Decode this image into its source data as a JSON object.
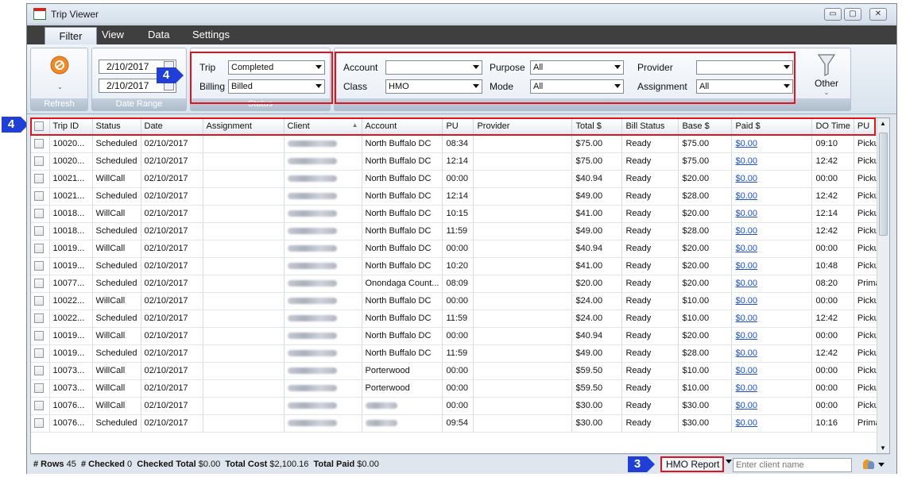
{
  "window": {
    "title": "Trip Viewer"
  },
  "titlebar_buttons": {
    "minimize": "▭",
    "maximize": "▢",
    "close": "✕"
  },
  "menu": {
    "tabs": [
      "Filter",
      "View",
      "Data",
      "Settings"
    ],
    "active": "Filter"
  },
  "ribbon": {
    "refresh": {
      "label": "Refresh"
    },
    "date_range": {
      "label": "Date Range",
      "from": "2/10/2017",
      "to": "2/10/2017"
    },
    "status": {
      "label": "Status",
      "trip_label": "Trip",
      "trip_value": "Completed",
      "billing_label": "Billing",
      "billing_value": "Billed"
    },
    "filters": {
      "account_label": "Account",
      "account_value": "",
      "class_label": "Class",
      "class_value": "HMO",
      "purpose_label": "Purpose",
      "purpose_value": "All",
      "mode_label": "Mode",
      "mode_value": "All",
      "provider_label": "Provider",
      "provider_value": "",
      "assignment_label": "Assignment",
      "assignment_value": "All"
    },
    "other": {
      "label": "Other"
    }
  },
  "markers": {
    "status": "4",
    "header": "4",
    "report": "3"
  },
  "grid": {
    "columns": [
      "Trip ID",
      "Status",
      "Date",
      "Assignment",
      "Client",
      "Account",
      "PU",
      "Provider",
      "Total $",
      "Bill Status",
      "Base $",
      "Paid $",
      "DO Time",
      "PU"
    ],
    "rows": [
      {
        "id": "10020...",
        "status": "Scheduled",
        "date": "02/10/2017",
        "account": "North Buffalo DC",
        "pu": "08:34",
        "total": "$75.00",
        "bill": "Ready",
        "base": "$75.00",
        "paid": "$0.00",
        "do": "09:10",
        "pu2": "Picku"
      },
      {
        "id": "10020...",
        "status": "Scheduled",
        "date": "02/10/2017",
        "account": "North Buffalo DC",
        "pu": "12:14",
        "total": "$75.00",
        "bill": "Ready",
        "base": "$75.00",
        "paid": "$0.00",
        "do": "12:42",
        "pu2": "Picku"
      },
      {
        "id": "10021...",
        "status": "WillCall",
        "date": "02/10/2017",
        "account": "North Buffalo DC",
        "pu": "00:00",
        "total": "$40.94",
        "bill": "Ready",
        "base": "$20.00",
        "paid": "$0.00",
        "do": "00:00",
        "pu2": "Picku"
      },
      {
        "id": "10021...",
        "status": "Scheduled",
        "date": "02/10/2017",
        "account": "North Buffalo DC",
        "pu": "12:14",
        "total": "$49.00",
        "bill": "Ready",
        "base": "$28.00",
        "paid": "$0.00",
        "do": "12:42",
        "pu2": "Picku"
      },
      {
        "id": "10018...",
        "status": "WillCall",
        "date": "02/10/2017",
        "account": "North Buffalo DC",
        "pu": "10:15",
        "total": "$41.00",
        "bill": "Ready",
        "base": "$20.00",
        "paid": "$0.00",
        "do": "12:14",
        "pu2": "Picku"
      },
      {
        "id": "10018...",
        "status": "Scheduled",
        "date": "02/10/2017",
        "account": "North Buffalo DC",
        "pu": "11:59",
        "total": "$49.00",
        "bill": "Ready",
        "base": "$28.00",
        "paid": "$0.00",
        "do": "12:42",
        "pu2": "Picku"
      },
      {
        "id": "10019...",
        "status": "WillCall",
        "date": "02/10/2017",
        "account": "North Buffalo DC",
        "pu": "00:00",
        "total": "$40.94",
        "bill": "Ready",
        "base": "$20.00",
        "paid": "$0.00",
        "do": "00:00",
        "pu2": "Picku"
      },
      {
        "id": "10019...",
        "status": "Scheduled",
        "date": "02/10/2017",
        "account": "North Buffalo DC",
        "pu": "10:20",
        "total": "$41.00",
        "bill": "Ready",
        "base": "$20.00",
        "paid": "$0.00",
        "do": "10:48",
        "pu2": "Picku"
      },
      {
        "id": "10077...",
        "status": "Scheduled",
        "date": "02/10/2017",
        "account": "Onondaga Count...",
        "pu": "08:09",
        "total": "$20.00",
        "bill": "Ready",
        "base": "$20.00",
        "paid": "$0.00",
        "do": "08:20",
        "pu2": "Prima"
      },
      {
        "id": "10022...",
        "status": "WillCall",
        "date": "02/10/2017",
        "account": "North Buffalo DC",
        "pu": "00:00",
        "total": "$24.00",
        "bill": "Ready",
        "base": "$10.00",
        "paid": "$0.00",
        "do": "00:00",
        "pu2": "Picku"
      },
      {
        "id": "10022...",
        "status": "Scheduled",
        "date": "02/10/2017",
        "account": "North Buffalo DC",
        "pu": "11:59",
        "total": "$24.00",
        "bill": "Ready",
        "base": "$10.00",
        "paid": "$0.00",
        "do": "12:42",
        "pu2": "Picku"
      },
      {
        "id": "10019...",
        "status": "WillCall",
        "date": "02/10/2017",
        "account": "North Buffalo DC",
        "pu": "00:00",
        "total": "$40.94",
        "bill": "Ready",
        "base": "$20.00",
        "paid": "$0.00",
        "do": "00:00",
        "pu2": "Picku"
      },
      {
        "id": "10019...",
        "status": "Scheduled",
        "date": "02/10/2017",
        "account": "North Buffalo DC",
        "pu": "11:59",
        "total": "$49.00",
        "bill": "Ready",
        "base": "$28.00",
        "paid": "$0.00",
        "do": "12:42",
        "pu2": "Picku"
      },
      {
        "id": "10073...",
        "status": "WillCall",
        "date": "02/10/2017",
        "account": "Porterwood",
        "pu": "00:00",
        "total": "$59.50",
        "bill": "Ready",
        "base": "$10.00",
        "paid": "$0.00",
        "do": "00:00",
        "pu2": "Picku"
      },
      {
        "id": "10073...",
        "status": "WillCall",
        "date": "02/10/2017",
        "account": "Porterwood",
        "pu": "00:00",
        "total": "$59.50",
        "bill": "Ready",
        "base": "$10.00",
        "paid": "$0.00",
        "do": "00:00",
        "pu2": "Picku"
      },
      {
        "id": "10076...",
        "status": "WillCall",
        "date": "02/10/2017",
        "account": "",
        "pu": "00:00",
        "total": "$30.00",
        "bill": "Ready",
        "base": "$30.00",
        "paid": "$0.00",
        "do": "00:00",
        "pu2": "Picku"
      },
      {
        "id": "10076...",
        "status": "Scheduled",
        "date": "02/10/2017",
        "account": "",
        "pu": "09:54",
        "total": "$30.00",
        "bill": "Ready",
        "base": "$30.00",
        "paid": "$0.00",
        "do": "10:16",
        "pu2": "Prima"
      }
    ]
  },
  "statusbar": {
    "rows_label": "# Rows",
    "rows_value": "45",
    "checked_label": "# Checked",
    "checked_value": "0",
    "checked_total_label": "Checked Total",
    "checked_total_value": "$0.00",
    "total_cost_label": "Total Cost",
    "total_cost_value": "$2,100.16",
    "total_paid_label": "Total Paid",
    "total_paid_value": "$0.00",
    "report_button": "HMO Report",
    "client_placeholder": "Enter client name"
  },
  "colors": {
    "highlight": "#e0141c",
    "marker": "#1f3fd6",
    "link": "#1f4fd1"
  }
}
